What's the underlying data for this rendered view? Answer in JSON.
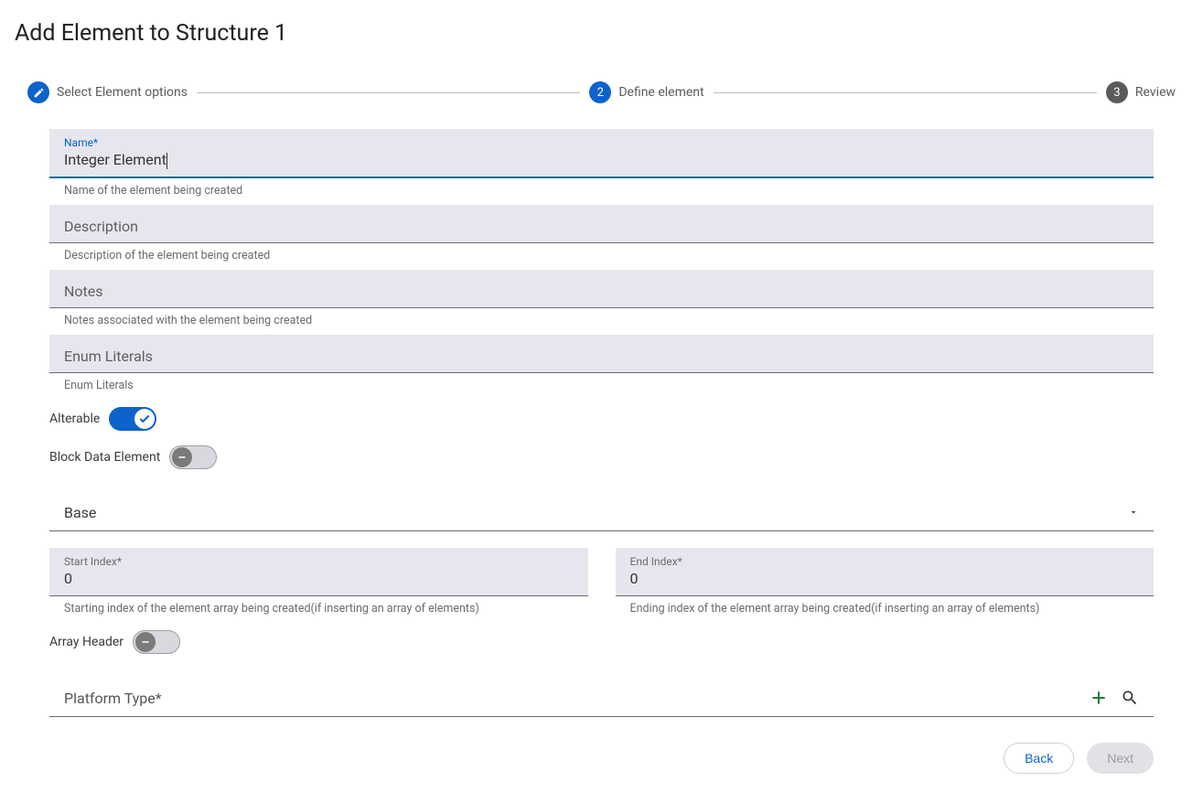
{
  "pageTitle": "Add Element to Structure 1",
  "stepper": {
    "step1": "Select Element options",
    "step2": "Define element",
    "step2Num": "2",
    "step3": "Review",
    "step3Num": "3"
  },
  "fields": {
    "name": {
      "label": "Name*",
      "value": "Integer Element",
      "helper": "Name of the element being created"
    },
    "description": {
      "placeholder": "Description",
      "helper": "Description of the element being created"
    },
    "notes": {
      "placeholder": "Notes",
      "helper": "Notes associated with the element being created"
    },
    "enumLiterals": {
      "placeholder": "Enum Literals",
      "helper": "Enum Literals"
    }
  },
  "toggles": {
    "alterable": {
      "label": "Alterable",
      "on": true
    },
    "blockData": {
      "label": "Block Data Element",
      "on": false
    },
    "arrayHeader": {
      "label": "Array Header",
      "on": false
    }
  },
  "base": {
    "label": "Base"
  },
  "startIndex": {
    "label": "Start Index*",
    "value": "0",
    "helper": "Starting index of the element array being created(if inserting an array of elements)"
  },
  "endIndex": {
    "label": "End Index*",
    "value": "0",
    "helper": "Ending index of the element array being created(if inserting an array of elements)"
  },
  "platform": {
    "label": "Platform Type*"
  },
  "buttons": {
    "back": "Back",
    "next": "Next"
  }
}
